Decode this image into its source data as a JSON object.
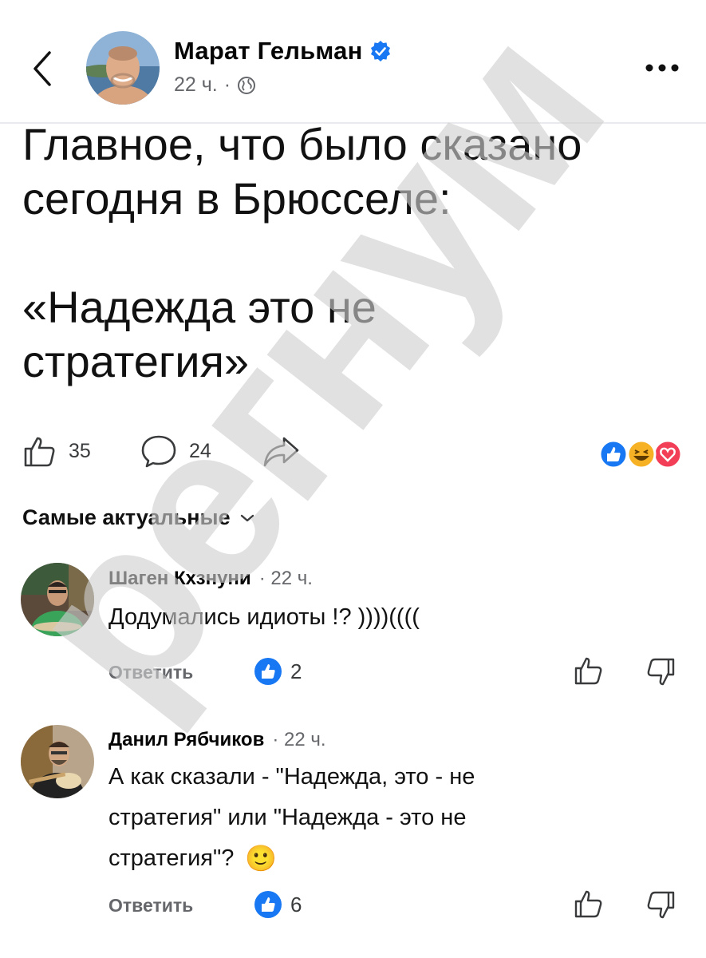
{
  "header": {
    "author_name": "Марат Гельман",
    "time": "22 ч.",
    "dot": "·",
    "back_icon": "chevron-left-icon",
    "more_icon": "more-dots-icon",
    "verified_icon": "verified-badge-icon",
    "privacy_icon": "globe-icon"
  },
  "post": {
    "lines": [
      "Главное, что было сказано",
      "сегодня в Брюсселе:",
      "",
      "«Надежда это не",
      "стратегия»"
    ]
  },
  "actions": {
    "likes": "35",
    "comments": "24",
    "reaction_icons": [
      "like-reaction-icon",
      "haha-reaction-icon",
      "love-reaction-icon"
    ]
  },
  "sort": {
    "label": "Самые актуальные"
  },
  "comments": [
    {
      "name": "Шаген Кхзнуни",
      "time": "22 ч.",
      "text": "Додумались идиоты !? ))))((((",
      "reply_label": "Ответить",
      "likes": "2"
    },
    {
      "name": "Данил Рябчиков",
      "time": "22 ч.",
      "text_lines": [
        "А как сказали - \"Надежда, это - не",
        "стратегия\" или \"Надежда - это не",
        "стратегия\"?"
      ],
      "reply_label": "Ответить",
      "likes": "6",
      "emoji": "🙂"
    }
  ],
  "watermark": {
    "text": "регнум"
  },
  "colors": {
    "facebook_blue": "#1877f2",
    "secondary_text": "#65676b",
    "love_red": "#f33e58",
    "haha_yellow": "#f7b125"
  }
}
